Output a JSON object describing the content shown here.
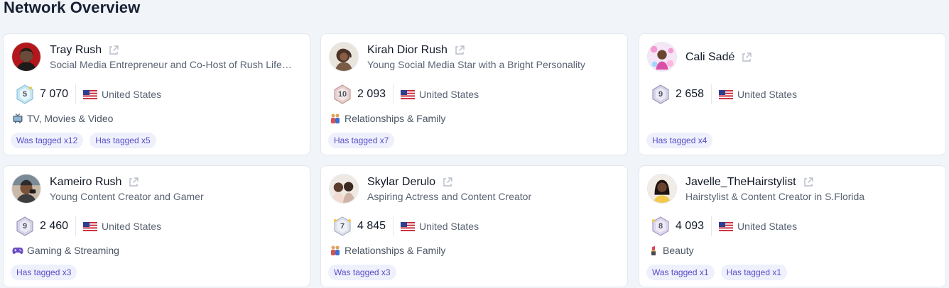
{
  "page": {
    "title": "Network Overview"
  },
  "colors": {
    "tag_bg": "#eef0fc",
    "tag_text": "#5a4cc8",
    "card_bg": "#ffffff",
    "page_bg": "#f1f4f8"
  },
  "profiles": [
    {
      "name": "Tray Rush",
      "bio": "Social Media Entrepreneur and Co-Host of Rush Life…",
      "rank": "5",
      "followers": "7 070",
      "country": "United States",
      "category": "TV, Movies & Video",
      "category_icon": "tv-icon",
      "tags": [
        "Was tagged x12",
        "Has tagged x5"
      ]
    },
    {
      "name": "Kirah Dior Rush",
      "bio": "Young Social Media Star with a Bright Personality",
      "rank": "10",
      "followers": "2 093",
      "country": "United States",
      "category": "Relationships & Family",
      "category_icon": "couple-icon",
      "tags": [
        "Has tagged x7"
      ]
    },
    {
      "name": "Cali Sadé",
      "bio": "",
      "rank": "9",
      "followers": "2 658",
      "country": "United States",
      "category": "",
      "category_icon": "",
      "tags": [
        "Has tagged x4"
      ]
    },
    {
      "name": "Kameiro Rush",
      "bio": "Young Content Creator and Gamer",
      "rank": "9",
      "followers": "2 460",
      "country": "United States",
      "category": "Gaming & Streaming",
      "category_icon": "gamepad-icon",
      "tags": [
        "Has tagged x3"
      ]
    },
    {
      "name": "Skylar Derulo",
      "bio": "Aspiring Actress and Content Creator",
      "rank": "7",
      "followers": "4 845",
      "country": "United States",
      "category": "Relationships & Family",
      "category_icon": "couple-icon",
      "tags": [
        "Was tagged x3"
      ]
    },
    {
      "name": "Javelle_TheHairstylist",
      "bio": "Hairstylist & Content Creator in S.Florida",
      "rank": "8",
      "followers": "4 093",
      "country": "United States",
      "category": "Beauty",
      "category_icon": "lipstick-icon",
      "tags": [
        "Was tagged x1",
        "Has tagged x1"
      ]
    }
  ]
}
